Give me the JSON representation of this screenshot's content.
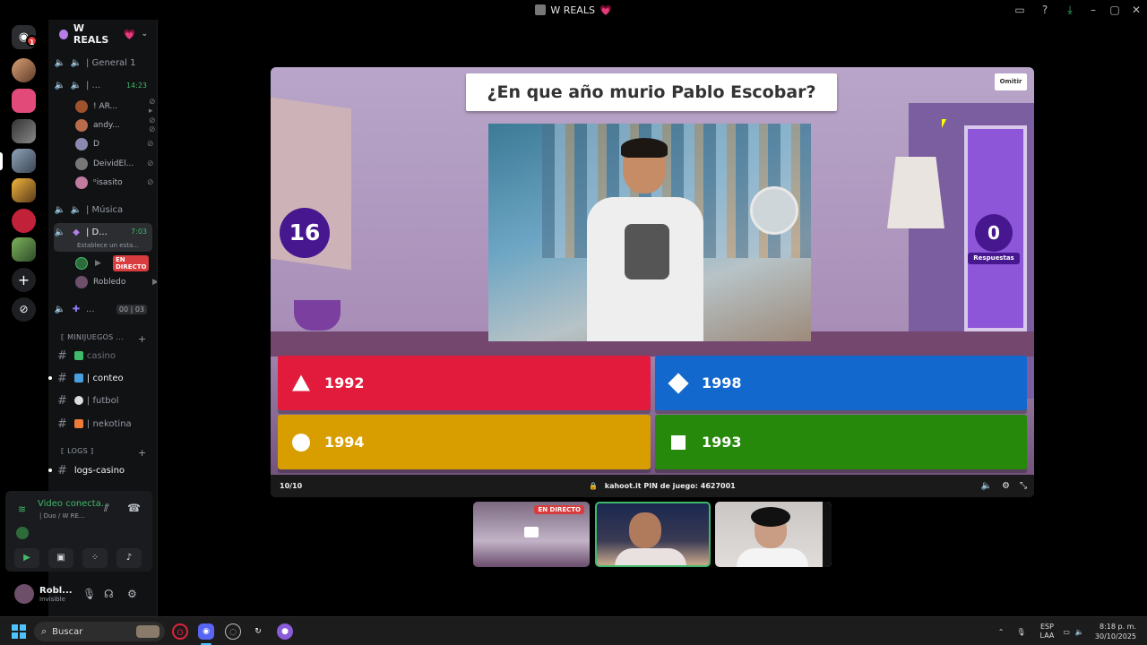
{
  "window": {
    "title": "W REALS",
    "title_heart": "💗"
  },
  "servers": {
    "unread_badge": "1"
  },
  "guild": {
    "name": "W REALS",
    "heart": "💗"
  },
  "voice_channels": [
    {
      "name": "| General 1"
    },
    {
      "name": "| ...",
      "time": "14:23"
    },
    {
      "name": "| Música"
    },
    {
      "name": "| D...",
      "time": "7:03",
      "status": "Establece un esta..."
    },
    {
      "name": "...",
      "counter": "00 | 03"
    }
  ],
  "voice_users_1": [
    {
      "name": "! AR..."
    },
    {
      "name": "andy..."
    },
    {
      "name": "D"
    },
    {
      "name": "DeividEl..."
    },
    {
      "name": "ᵒisasito"
    }
  ],
  "voice_users_2": [
    {
      "name": "",
      "live": "EN DIRECTO"
    },
    {
      "name": "Robledo"
    }
  ],
  "categories": [
    {
      "name": "⟦ MINIJUEGOS ..."
    },
    {
      "name": "⟦ LOGS ⟧"
    }
  ],
  "text_channels": [
    {
      "name": "casino"
    },
    {
      "name": "| conteo"
    },
    {
      "name": "| futbol"
    },
    {
      "name": "| nekotina"
    },
    {
      "name": "logs-casino"
    }
  ],
  "voice_panel": {
    "status": "Video conecta...",
    "server": "| Duo / W RE..."
  },
  "user_panel": {
    "name": "Robl...",
    "status": "Invisible"
  },
  "kahoot": {
    "question": "¿En que año murio Pablo Escobar?",
    "skip": "Omitir",
    "timer": "16",
    "answers_count": "0",
    "answers_label": "Respuestas",
    "answers": [
      {
        "label": "1992",
        "shape": "triangle",
        "color": "#e21b3c"
      },
      {
        "label": "1998",
        "shape": "diamond",
        "color": "#1368ce"
      },
      {
        "label": "1994",
        "shape": "circle",
        "color": "#d89e00"
      },
      {
        "label": "1993",
        "shape": "square",
        "color": "#26890c"
      }
    ],
    "progress": "10/10",
    "site": "kahoot.it",
    "pin_label": "PIN de juego:",
    "pin": "4627001"
  },
  "participants": [
    {
      "live": "EN DIRECTO"
    },
    {
      "speaking": true
    },
    {}
  ],
  "taskbar": {
    "search": "Buscar",
    "lang_top": "ESP",
    "lang_bottom": "LAA",
    "time": "8:18 p. m.",
    "date": "30/10/2025"
  }
}
